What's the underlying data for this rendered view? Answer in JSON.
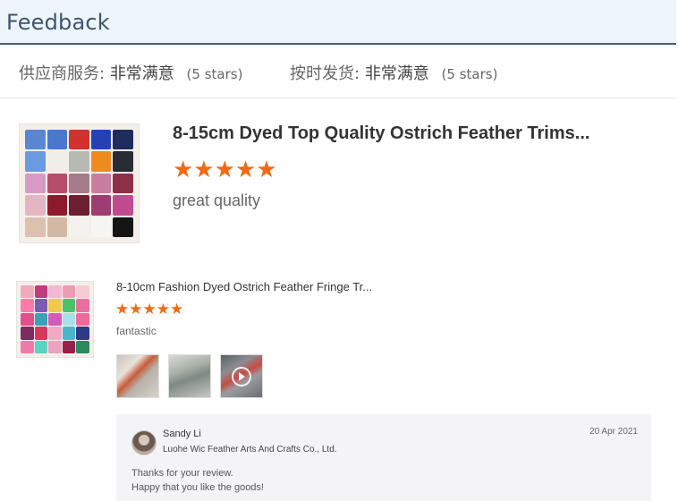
{
  "header": {
    "title": "Feedback"
  },
  "ratings": [
    {
      "label": "供应商服务:",
      "value": "非常满意",
      "stars": "(5 stars)"
    },
    {
      "label": "按时发货:",
      "value": "非常满意",
      "stars": "(5 stars)"
    }
  ],
  "reviews": [
    {
      "title": "8-15cm Dyed Top Quality Ostrich Feather Trims...",
      "stars": "★★★★★",
      "rating": 5,
      "text": "great quality",
      "thumb_colors": [
        "#5b86d6",
        "#4a78d0",
        "#d3312f",
        "#2343b5",
        "#1f2d5c",
        "#6a9be0",
        "#f1eee7",
        "#b7b9b3",
        "#f08a1e",
        "#2a2c33",
        "#d89ac6",
        "#b84d6b",
        "#a37b8a",
        "#c97ea1",
        "#8b3046",
        "#e4b5c2",
        "#8f1a2c",
        "#6b1f2f",
        "#9e3d72",
        "#c14a8f",
        "#dcc1ae",
        "#d3b9a3",
        "#f4f1ee",
        "#f7f5f2",
        "#151515"
      ]
    },
    {
      "title": "8-10cm Fashion Dyed Ostrich Feather Fringe Tr...",
      "stars": "★★★★★",
      "rating": 5,
      "text": "fantastic",
      "thumb_colors": [
        "#f2a9c0",
        "#c33c7a",
        "#f3b7d4",
        "#ee9bb4",
        "#f6cbd3",
        "#ff7aa8",
        "#7b5bb2",
        "#f0c94b",
        "#4ec06a",
        "#e86fa0",
        "#e34f8c",
        "#3aa1b8",
        "#d45bb8",
        "#a8e0e8",
        "#ef6a9c",
        "#7e2a63",
        "#d6395e",
        "#f3a8c4",
        "#4bb6c9",
        "#2b3b85",
        "#f07aa8",
        "#5cd2c2",
        "#e9a2c0",
        "#9a1e4a",
        "#2c8a5e"
      ],
      "photos": [
        {
          "name": "review-photo-1",
          "video": false
        },
        {
          "name": "review-photo-2",
          "video": false
        },
        {
          "name": "review-video-3",
          "video": true
        }
      ],
      "reply": {
        "name": "Sandy Li",
        "company": "Luohe Wic Feather Arts And Crafts Co., Ltd.",
        "date": "20 Apr 2021",
        "line1": "Thanks for your review.",
        "line2": "Happy that you like the goods!"
      }
    }
  ]
}
